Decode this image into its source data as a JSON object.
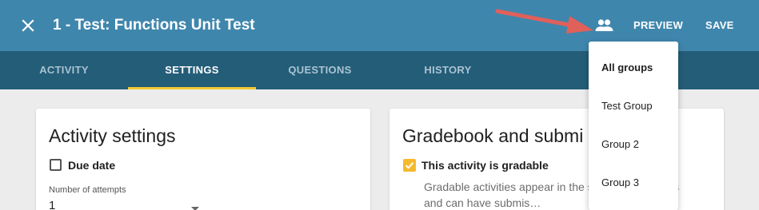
{
  "header": {
    "title": "1 - Test: Functions Unit Test",
    "preview_label": "PREVIEW",
    "save_label": "SAVE",
    "bar_color": "#3f86ad"
  },
  "tabs": [
    {
      "label": "ACTIVITY",
      "active": false
    },
    {
      "label": "SETTINGS",
      "active": true
    },
    {
      "label": "QUESTIONS",
      "active": false
    },
    {
      "label": "HISTORY",
      "active": false
    }
  ],
  "activity_settings": {
    "title": "Activity settings",
    "due_date_label": "Due date",
    "due_date_checked": false,
    "attempts_label": "Number of attempts",
    "attempts_value": "1"
  },
  "gradebook": {
    "title": "Gradebook and submi",
    "gradable_label": "This activity is gradable",
    "gradable_checked": true,
    "description": "Gradable activities appear in the s… er gradebooks and can have submis…"
  },
  "group_menu": {
    "items": [
      {
        "label": "All groups",
        "selected": true
      },
      {
        "label": "Test Group",
        "selected": false
      },
      {
        "label": "Group 2",
        "selected": false
      },
      {
        "label": "Group 3",
        "selected": false
      }
    ]
  },
  "icons": {
    "close": "close-icon",
    "groups": "people-icon",
    "dropdown": "arrow-drop-down-icon"
  }
}
